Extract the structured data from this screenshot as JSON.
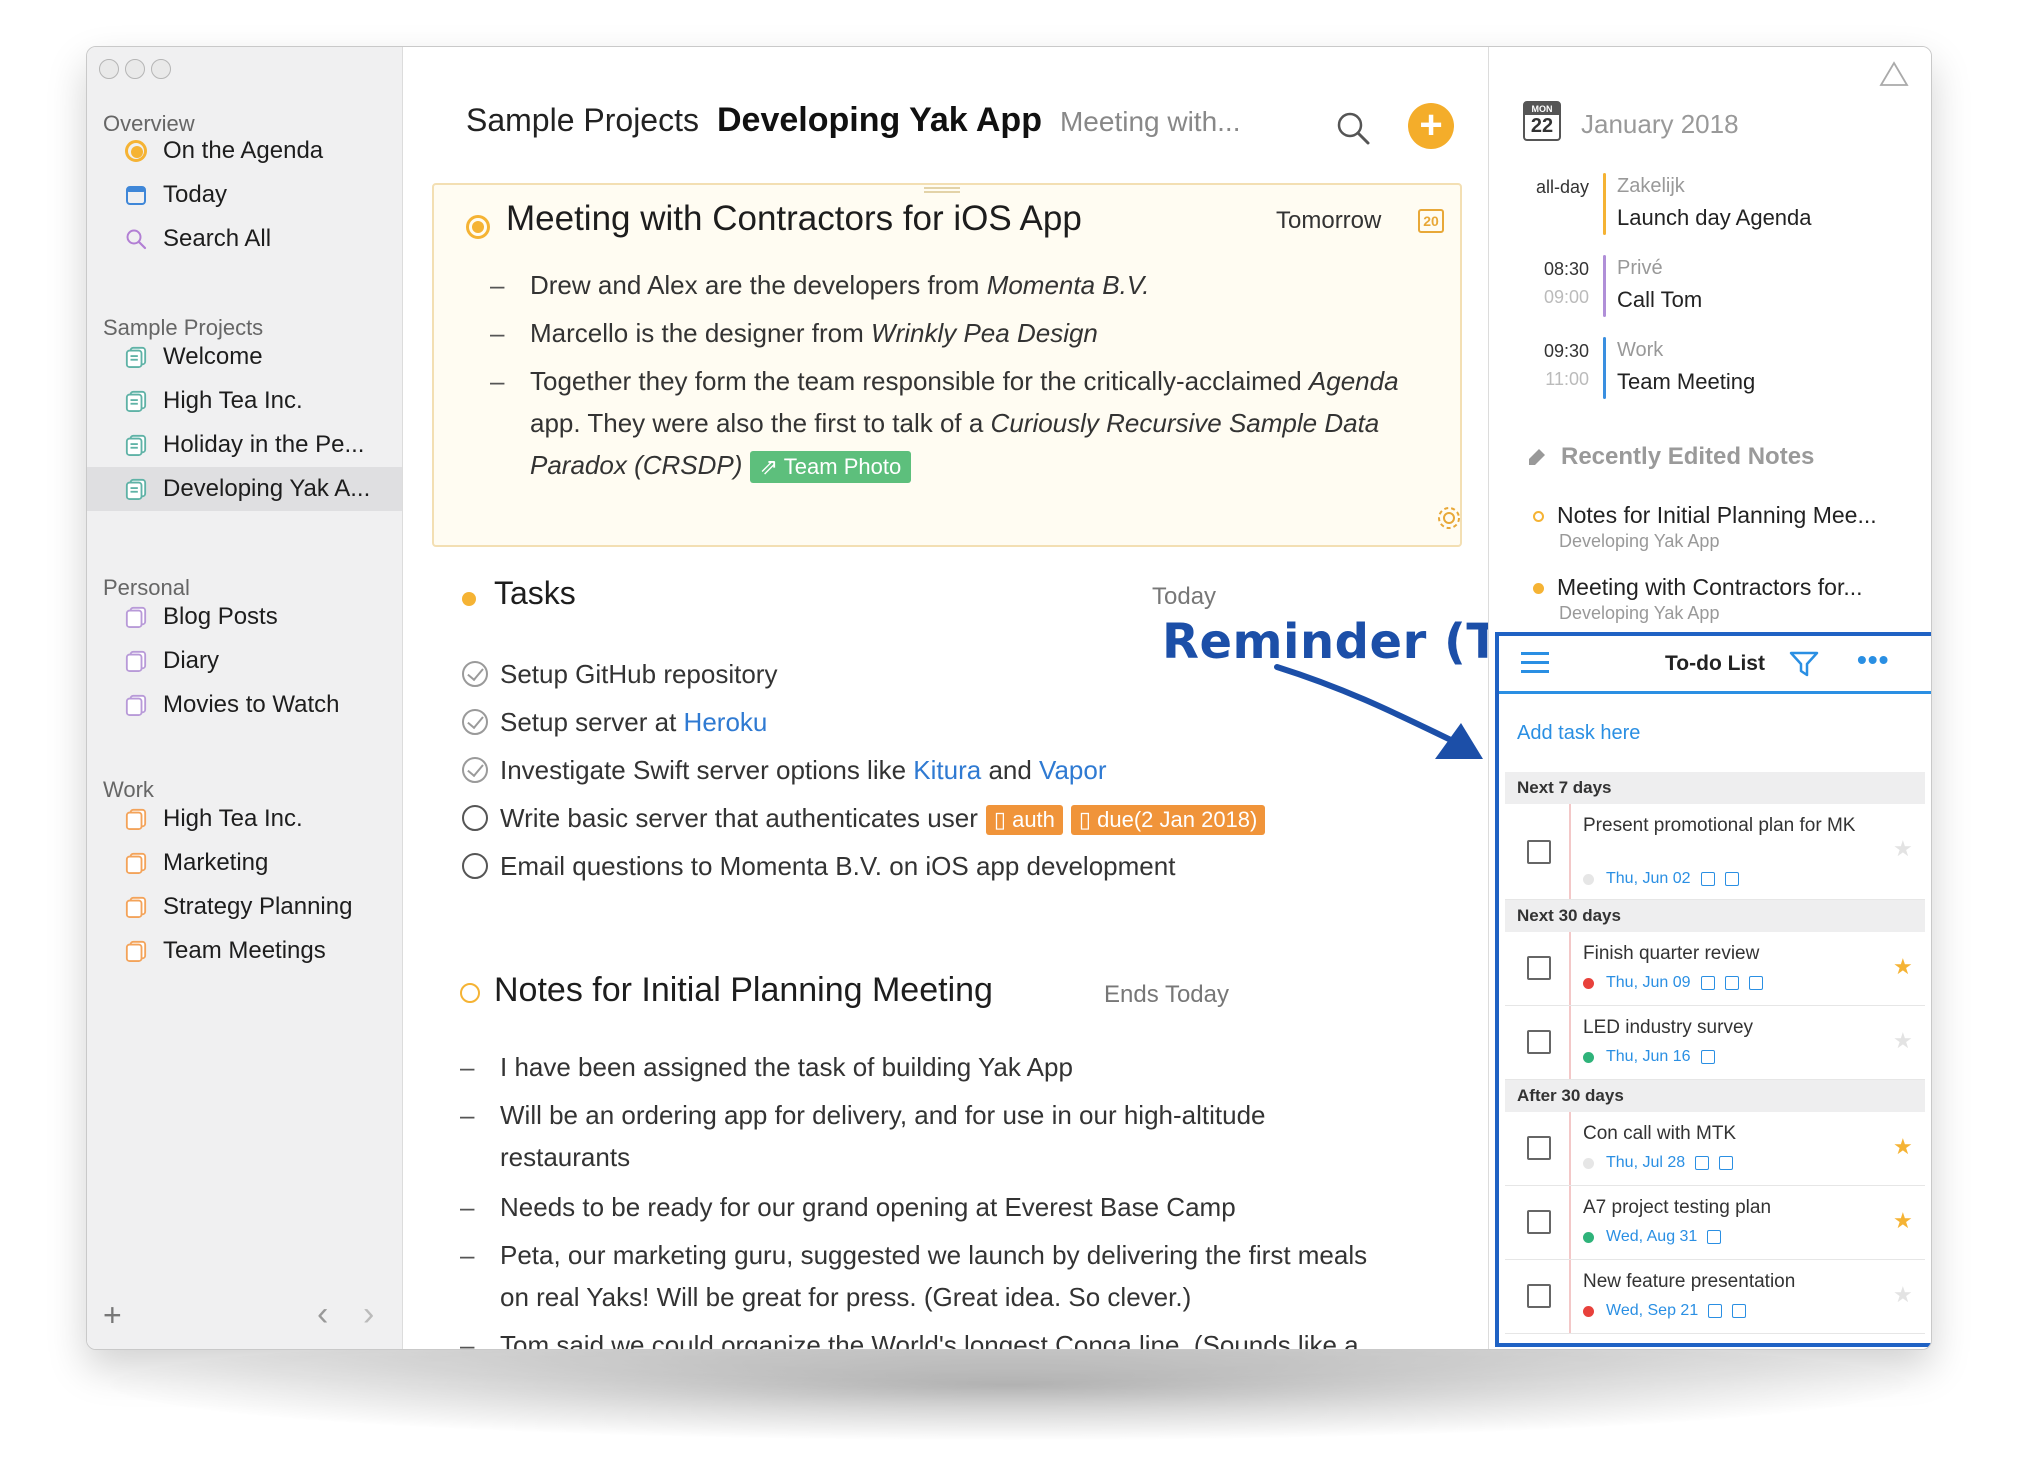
{
  "sidebar": {
    "sections": [
      {
        "title": "Overview"
      },
      {
        "title": "Sample Projects"
      },
      {
        "title": "Personal"
      },
      {
        "title": "Work"
      }
    ],
    "overview": [
      "On the Agenda",
      "Today",
      "Search All"
    ],
    "sample_projects": [
      "Welcome",
      "High Tea Inc.",
      "Holiday in the Pe...",
      "Developing Yak A..."
    ],
    "personal": [
      "Blog Posts",
      "Diary",
      "Movies to Watch"
    ],
    "work": [
      "High Tea Inc.",
      "Marketing",
      "Strategy Planning",
      "Team Meetings"
    ],
    "footer": {
      "add": "+",
      "back": "‹",
      "forward": "›"
    }
  },
  "header": {
    "crumb_project_group": "Sample Projects",
    "crumb_project": "Developing Yak App",
    "crumb_note": "Meeting with...",
    "add_label": "+"
  },
  "note1": {
    "title": "Meeting with Contractors for iOS App",
    "date": "Tomorrow",
    "cal_day": "20",
    "b1_pre": "Drew and Alex are the developers from ",
    "b1_em": "Momenta B.V.",
    "b2_pre": "Marcello is the designer from ",
    "b2_em": "Wrinkly Pea Design",
    "b3_pre": "Together they form the team responsible for the critically-acclaimed ",
    "b3_em": "Agenda",
    "b3_line2_pre": "app. They were also the first to talk of a ",
    "b3_line2_em": "Curiously Recursive Sample Data",
    "b3_line3_em": "Paradox (CRSDP)",
    "b3_tag": "⇗ Team Photo",
    "dash": "–"
  },
  "tasks": {
    "title": "Tasks",
    "date": "Today",
    "items": [
      {
        "pre": "Setup GitHub repository",
        "done": true
      },
      {
        "pre": "Setup server at ",
        "link1": "Heroku",
        "done": true
      },
      {
        "pre": "Investigate Swift server options like ",
        "link1": "Kitura",
        "mid": " and ",
        "link2": "Vapor",
        "done": true
      },
      {
        "pre": "Write basic server that authenticates user",
        "tag1": "▯ auth",
        "tag2": "▯ due(2 Jan 2018)",
        "done": false
      },
      {
        "pre": "Email questions to Momenta B.V. on iOS app development",
        "done": false
      }
    ]
  },
  "callout": {
    "text": "Reminder (To-do) View"
  },
  "note2": {
    "title": "Notes for Initial Planning Meeting",
    "date": "Ends Today",
    "bullets": [
      "I have been assigned the task of building Yak App",
      "Will be an ordering app for delivery, and for use in our high-altitude",
      "restaurants",
      "Needs to be ready for our grand opening at Everest Base Camp",
      "Peta, our marketing guru, suggested we launch by delivering the first meals",
      "on real Yaks! Will be great for press. (Great idea. So clever.)",
      "Tom said we could organize the World's longest Conga line. (Sounds like a"
    ]
  },
  "calendar": {
    "cal_month_abbr": "MON",
    "cal_day": "22",
    "month": "January 2018",
    "events": [
      {
        "time": "all-day",
        "end": "",
        "calendar": "Zakelijk",
        "title": "Launch day Agenda",
        "color": "#f5b334"
      },
      {
        "time": "08:30",
        "end": "09:00",
        "calendar": "Privé",
        "title": "Call Tom",
        "color": "#b08fd8"
      },
      {
        "time": "09:30",
        "end": "11:00",
        "calendar": "Work",
        "title": "Team Meeting",
        "color": "#3a8fe0"
      }
    ]
  },
  "recent": {
    "title": "Recently Edited Notes",
    "items": [
      {
        "title": "Notes for Initial Planning Mee...",
        "sub": "Developing Yak App"
      },
      {
        "title": "Meeting with Contractors for...",
        "sub": "Developing Yak App"
      }
    ]
  },
  "todo": {
    "title": "To-do List",
    "more": "•••",
    "add_placeholder": "Add task here",
    "groups": [
      "Next 7 days",
      "Next 30 days",
      "After 30 days"
    ],
    "items": [
      {
        "title": "Present promotional plan for MK",
        "date": "Thu, Jun 02",
        "priority": "#e6e6e6",
        "starred": false
      },
      {
        "title": "Finish quarter review",
        "date": "Thu, Jun 09",
        "priority": "#e8413b",
        "starred": true
      },
      {
        "title": "LED industry survey",
        "date": "Thu, Jun 16",
        "priority": "#2fb37a",
        "starred": false
      },
      {
        "title": "Con call with MTK",
        "date": "Thu, Jul 28",
        "priority": "#e6e6e6",
        "starred": true
      },
      {
        "title": "A7 project testing plan",
        "date": "Wed, Aug 31",
        "priority": "#2fb37a",
        "starred": true
      },
      {
        "title": "New feature presentation",
        "date": "Wed, Sep 21",
        "priority": "#e8413b",
        "starred": false
      }
    ],
    "star_glyph": "★"
  },
  "colors": {
    "accent": "#f5b334",
    "link": "#2f7ad2",
    "todo_blue": "#2a8fe3",
    "callout": "#1c4fa8"
  }
}
